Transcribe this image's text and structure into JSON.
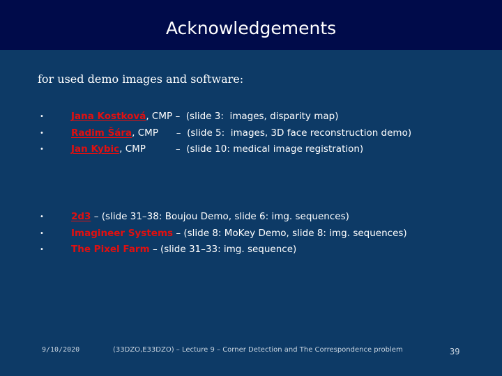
{
  "title": "Acknowledgements",
  "intro": "for used demo images and software:",
  "people": [
    {
      "name": "Jana Kostková",
      "affil": ", CMP",
      "gap": " –  ",
      "desc": "(slide 3:  images, disparity map)"
    },
    {
      "name": "Radim Šára",
      "affil": ", CMP",
      "gap": "      –  ",
      "desc": "(slide 5:  images, 3D face reconstruction demo)"
    },
    {
      "name": "Jan Kybic",
      "affil": ", CMP",
      "gap": "          –  ",
      "desc": "(slide 10: medical image registration)"
    }
  ],
  "companies": [
    {
      "name": "2d3",
      "desc": " – (slide 31–38: Boujou Demo, slide 6: img. sequences)"
    },
    {
      "name": "Imagineer Systems",
      "desc": " – (slide 8: MoKey Demo, slide 8: img. sequences)"
    },
    {
      "name": "The Pixel Farm",
      "desc": " – (slide 31–33: img. sequence)"
    }
  ],
  "bullet": "•",
  "footer": {
    "date": "9/10/2020",
    "course": "(33DZO,E33DZO) – Lecture 9 – Corner Detection and The Correspondence problem",
    "slide_number": "39"
  }
}
